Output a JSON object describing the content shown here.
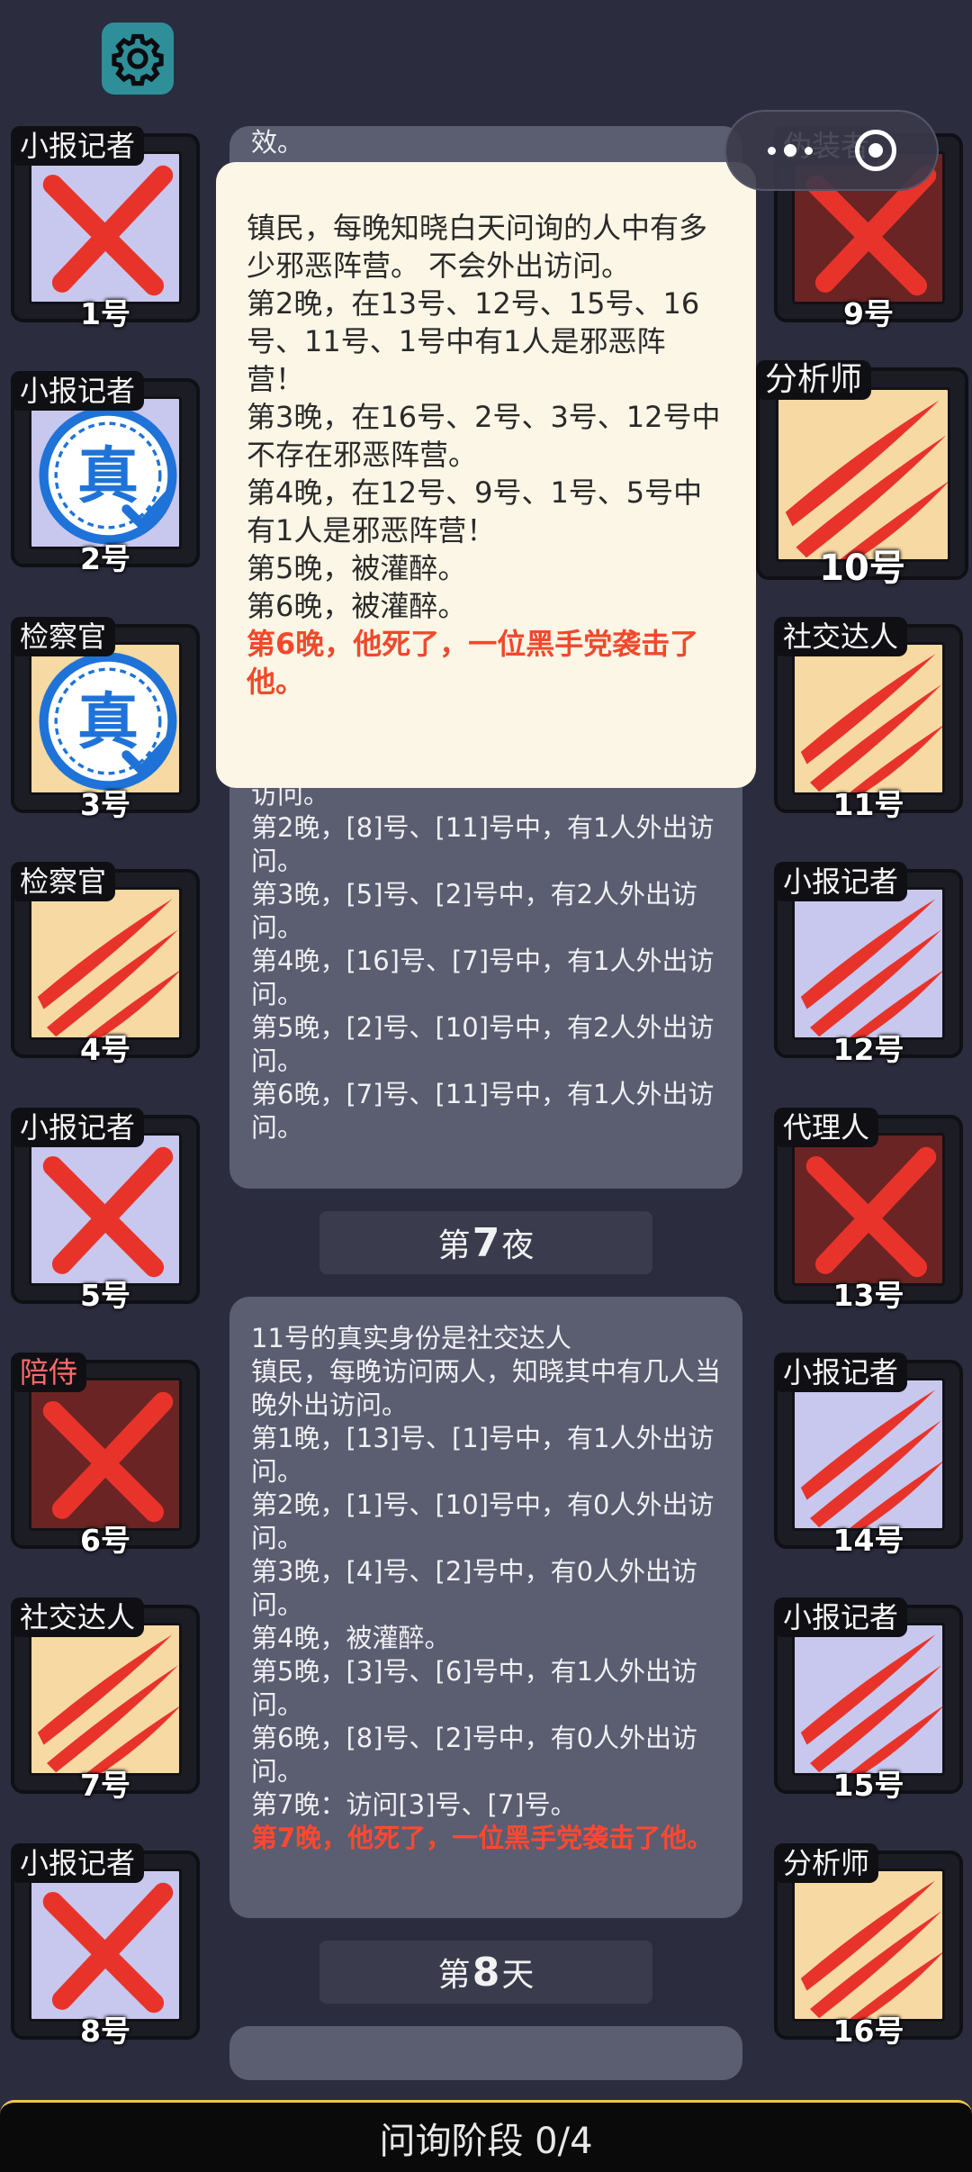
{
  "settings": {
    "icon": "gear-icon"
  },
  "capsule": {
    "icons": [
      "more-dots-icon",
      "close-circle-icon"
    ]
  },
  "tooltip": {
    "lines": [
      "镇民，每晚知晓白天问询的人中有多少邪恶阵营。 不会外出访问。",
      "第2晚，在13号、12号、15号、16号、11号、1号中有1人是邪恶阵营！",
      "第3晚，在16号、2号、3号、12号中不存在邪恶阵营。",
      "第4晚，在12号、9号、1号、5号中有1人是邪恶阵营！",
      "第5晚，被灌醉。",
      "第6晚，被灌醉。"
    ],
    "death": "第6晚，他死了，一位黑手党袭击了他。"
  },
  "top_fragment": {
    "text": "效。"
  },
  "panel1": {
    "lines": [
      "访问。",
      "第2晚，[8]号、[11]号中，有1人外出访问。",
      "第3晚，[5]号、[2]号中，有2人外出访问。",
      "第4晚，[16]号、[7]号中，有1人外出访问。",
      "第5晚，[2]号、[10]号中，有2人外出访问。",
      "第6晚，[7]号、[11]号中，有1人外出访问。"
    ]
  },
  "divider1": {
    "prefix": "第",
    "number": "7",
    "suffix": "夜"
  },
  "panel2": {
    "lines": [
      "11号的真实身份是社交达人",
      "镇民，每晚访问两人，知晓其中有几人当晚外出访问。",
      "第1晚，[13]号、[1]号中，有1人外出访问。",
      "第2晚，[1]号、[10]号中，有0人外出访问。",
      "第3晚，[4]号、[2]号中，有0人外出访问。",
      "第4晚，被灌醉。",
      "第5晚，[3]号、[6]号中，有1人外出访问。",
      "第6晚，[8]号、[2]号中，有0人外出访问。",
      "第7晚：访问[3]号、[7]号。"
    ],
    "death": "第7晚，他死了，一位黑手党袭击了他。"
  },
  "divider2": {
    "prefix": "第",
    "number": "8",
    "suffix": "天"
  },
  "players": [
    {
      "num": "1号",
      "role": "小报记者",
      "bg": "lav",
      "mark": "x"
    },
    {
      "num": "2号",
      "role": "小报记者",
      "bg": "lav",
      "mark": "seal"
    },
    {
      "num": "3号",
      "role": "检察官",
      "bg": "tan",
      "mark": "seal"
    },
    {
      "num": "4号",
      "role": "检察官",
      "bg": "tan",
      "mark": "claw"
    },
    {
      "num": "5号",
      "role": "小报记者",
      "bg": "lav",
      "mark": "x"
    },
    {
      "num": "6号",
      "role": "陪侍",
      "bg": "red",
      "mark": "x"
    },
    {
      "num": "7号",
      "role": "社交达人",
      "bg": "tan",
      "mark": "claw"
    },
    {
      "num": "8号",
      "role": "小报记者",
      "bg": "lav",
      "mark": "x"
    },
    {
      "num": "9号",
      "role": "伪装者",
      "bg": "red",
      "mark": "x"
    },
    {
      "num": "10号",
      "role": "分析师",
      "bg": "tan",
      "mark": "claw"
    },
    {
      "num": "11号",
      "role": "社交达人",
      "bg": "tan",
      "mark": "claw"
    },
    {
      "num": "12号",
      "role": "小报记者",
      "bg": "lav",
      "mark": "claw"
    },
    {
      "num": "13号",
      "role": "代理人",
      "bg": "red",
      "mark": "x"
    },
    {
      "num": "14号",
      "role": "小报记者",
      "bg": "lav",
      "mark": "claw"
    },
    {
      "num": "15号",
      "role": "小报记者",
      "bg": "lav",
      "mark": "claw"
    },
    {
      "num": "16号",
      "role": "分析师",
      "bg": "tan",
      "mark": "claw"
    }
  ],
  "seal_text": "真",
  "bottom_bar": {
    "text": "问询阶段 0/4"
  },
  "colors": {
    "death_text": "#ff4830",
    "x_mark": "#e8332b",
    "seal_blue": "#1f73d8"
  }
}
